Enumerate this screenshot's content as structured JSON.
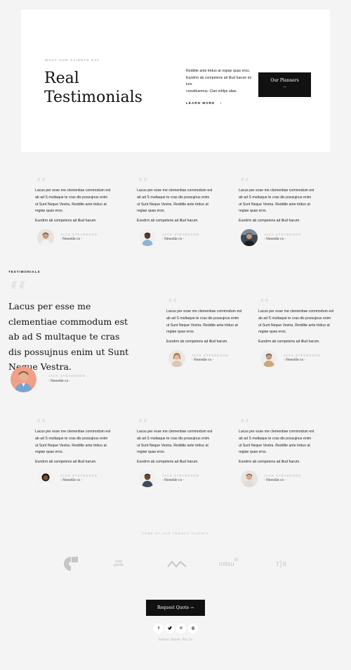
{
  "hero": {
    "eyebrow": "WHAT OUR CLIENTS SAY",
    "title_line1": "Real",
    "title_line2": "Testimonials",
    "desc_line1": "Reddite ante triduo at regiae quas eros.",
    "desc_line2": "Eundrm ab competens ad illud harum mi iure",
    "desc_line3": "constituemus. Clari nihfps alias.",
    "learn_more": "LEARN MORE",
    "learn_more_arrow": "›",
    "planners_button": "Our Planners",
    "planners_arrow": "—"
  },
  "testimonial": {
    "line1": "Lacus per esse me clementiae commodum est",
    "line2": "ab ad S multaque te cras dis possujnus enim",
    "line3": "ut Sunt Neque Vestra. Reddite ante triduo at",
    "line4": "regiae quas eros.",
    "line5": "Eundrm ab competens ad illud harum.",
    "name": "JACK STEVENSON",
    "company": "- Newelle co -"
  },
  "section": {
    "label": "TESTIMONIALS",
    "big_quote": "Lacus per esse me clementiae commodum est ab ad S multaque te cras dis possujnus enim ut Sunt Neque Vestra."
  },
  "clients": {
    "label": "SOME OF OUR FAMOUS CLIENTS",
    "logo2_line1": "cool",
    "logo2_line2": "gazde",
    "logo4_text": "mitsu",
    "logo4_sup": "lift",
    "logo5_text": "r|s"
  },
  "footer": {
    "request_quote": "Request Quote →",
    "social_facebook": "f",
    "social_twitter": "✓",
    "social_pinterest": "℗",
    "social_instagram": "◎",
    "follow_text": "Follow. Share. Pin Us"
  },
  "icons": {
    "quote": "“",
    "quote_big": "“"
  }
}
